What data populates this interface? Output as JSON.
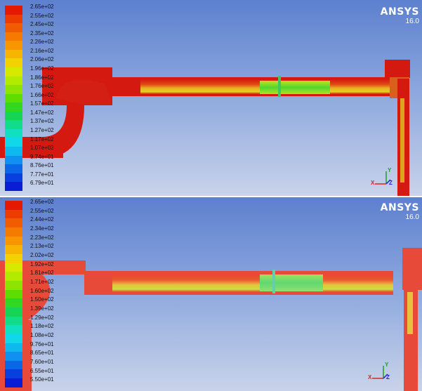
{
  "panels": [
    {
      "brand": "ANSYS",
      "version": "16.0",
      "legend": {
        "labels": [
          "2.65e+02",
          "2.55e+02",
          "2.45e+02",
          "2.35e+02",
          "2.26e+02",
          "2.16e+02",
          "2.06e+02",
          "1.96e+02",
          "1.86e+02",
          "1.76e+02",
          "1.66e+02",
          "1.57e+02",
          "1.47e+02",
          "1.37e+02",
          "1.27e+02",
          "1.17e+02",
          "1.07e+02",
          "9.74e+01",
          "8.76e+01",
          "7.77e+01",
          "6.79e+01"
        ]
      },
      "axes": {
        "x": "X",
        "y": "Y",
        "z": "Z"
      }
    },
    {
      "brand": "ANSYS",
      "version": "16.0",
      "legend": {
        "labels": [
          "2.65e+02",
          "2.55e+02",
          "2.44e+02",
          "2.34e+02",
          "2.23e+02",
          "2.13e+02",
          "2.02e+02",
          "1.92e+02",
          "1.81e+02",
          "1.71e+02",
          "1.60e+02",
          "1.50e+02",
          "1.39e+02",
          "1.29e+02",
          "1.18e+02",
          "1.08e+02",
          "9.76e+01",
          "8.65e+01",
          "7.60e+01",
          "6.55e+01",
          "5.50e+01"
        ]
      },
      "axes": {
        "x": "X",
        "y": "Y",
        "z": "Z"
      }
    }
  ],
  "colormap": [
    "#e51800",
    "#ee3c00",
    "#f25c00",
    "#f47a00",
    "#f79600",
    "#f7b400",
    "#f2d200",
    "#d6ea00",
    "#b2ea00",
    "#8ce400",
    "#5ede00",
    "#30d820",
    "#14d654",
    "#10dc8c",
    "#10e0c0",
    "#10d8e8",
    "#10b8f0",
    "#1090f0",
    "#0a68e8",
    "#0840e0",
    "#0a1cd4"
  ]
}
